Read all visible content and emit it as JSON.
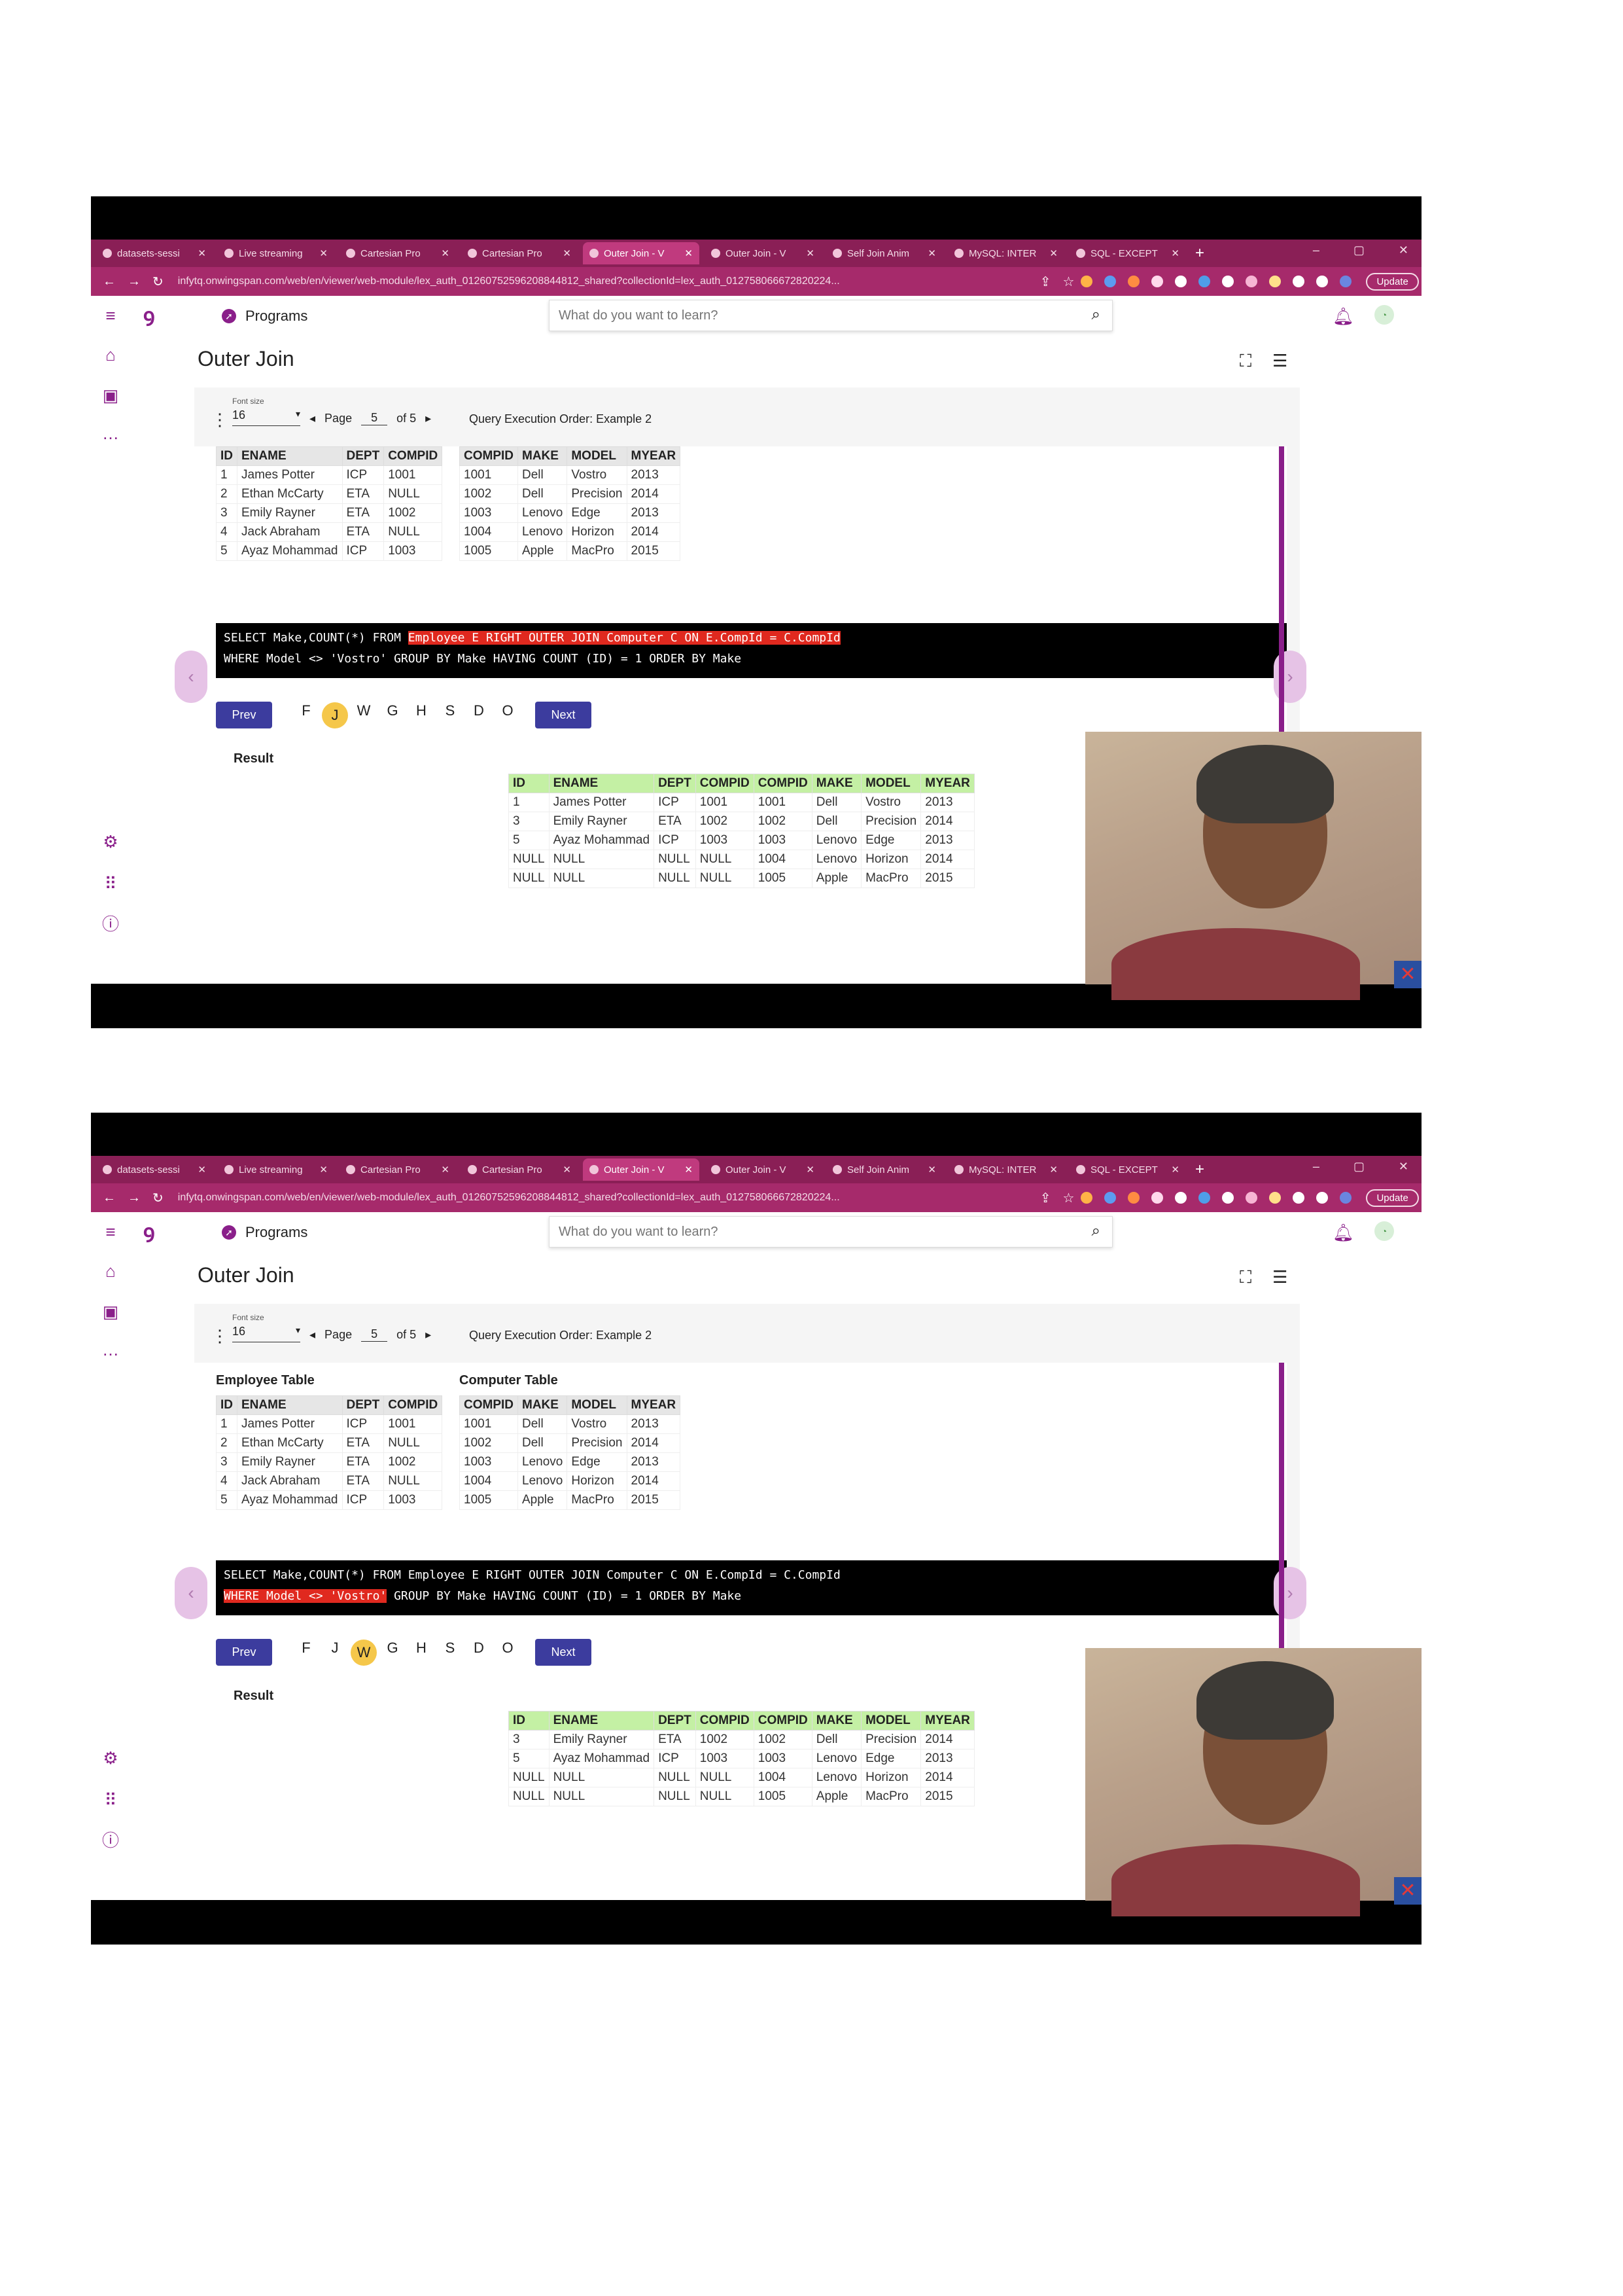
{
  "browser": {
    "tabs": [
      {
        "title": "datasets-sessi",
        "active": false
      },
      {
        "title": "Live streaming",
        "active": false
      },
      {
        "title": "Cartesian Pro",
        "active": false
      },
      {
        "title": "Cartesian Pro",
        "active": false
      },
      {
        "title": "Outer Join - V",
        "active": true
      },
      {
        "title": "Outer Join - V",
        "active": false
      },
      {
        "title": "Self Join Anim",
        "active": false
      },
      {
        "title": "MySQL: INTER",
        "active": false
      },
      {
        "title": "SQL - EXCEPT",
        "active": false
      }
    ],
    "url": "infytq.onwingspan.com/web/en/viewer/web-module/lex_auth_0126075259620884481​2_shared?collectionId=lex_auth_012758066672820224...",
    "update_label": "Update"
  },
  "app": {
    "programs_label": "Programs",
    "search_placeholder": "What do you want to learn?",
    "page_title": "Outer Join",
    "font_size_label": "Font size",
    "font_size_value": "16",
    "page_label": "Page",
    "page_value": "5",
    "page_of": "of 5",
    "query_title": "Query Execution Order: Example 2",
    "employee_table_title": "Employee Table",
    "computer_table_title": "Computer Table",
    "result_label": "Result",
    "prev_label": "Prev",
    "next_label": "Next"
  },
  "employee_table": {
    "headers": [
      "ID",
      "ENAME",
      "DEPT",
      "COMPID"
    ],
    "rows": [
      [
        "1",
        "James Potter",
        "ICP",
        "1001"
      ],
      [
        "2",
        "Ethan McCarty",
        "ETA",
        "NULL"
      ],
      [
        "3",
        "Emily Rayner",
        "ETA",
        "1002"
      ],
      [
        "4",
        "Jack Abraham",
        "ETA",
        "NULL"
      ],
      [
        "5",
        "Ayaz Mohammad",
        "ICP",
        "1003"
      ]
    ]
  },
  "computer_table": {
    "headers": [
      "COMPID",
      "MAKE",
      "MODEL",
      "MYEAR"
    ],
    "rows": [
      [
        "1001",
        "Dell",
        "Vostro",
        "2013"
      ],
      [
        "1002",
        "Dell",
        "Precision",
        "2014"
      ],
      [
        "1003",
        "Lenovo",
        "Edge",
        "2013"
      ],
      [
        "1004",
        "Lenovo",
        "Horizon",
        "2014"
      ],
      [
        "1005",
        "Apple",
        "MacPro",
        "2015"
      ]
    ]
  },
  "result_headers": [
    "ID",
    "ENAME",
    "DEPT",
    "COMPID",
    "COMPID",
    "MAKE",
    "MODEL",
    "MYEAR"
  ],
  "frames": [
    {
      "sql_line1_pre": "SELECT Make,COUNT(*) FROM ",
      "sql_line1_hl": "Employee E RIGHT OUTER JOIN Computer C ON E.CompId = C.CompId",
      "sql_line1_post": "",
      "sql_line2_hl": "",
      "sql_line2_post": "WHERE Model <> 'Vostro' GROUP BY Make HAVING COUNT (ID) = 1 ORDER BY Make",
      "steps": [
        "F",
        "J",
        "W",
        "G",
        "H",
        "S",
        "D",
        "O"
      ],
      "current_step": "J",
      "result_rows": [
        [
          "1",
          "James Potter",
          "ICP",
          "1001",
          "1001",
          "Dell",
          "Vostro",
          "2013"
        ],
        [
          "3",
          "Emily Rayner",
          "ETA",
          "1002",
          "1002",
          "Dell",
          "Precision",
          "2014"
        ],
        [
          "5",
          "Ayaz Mohammad",
          "ICP",
          "1003",
          "1003",
          "Lenovo",
          "Edge",
          "2013"
        ],
        [
          "NULL",
          "NULL",
          "NULL",
          "NULL",
          "1004",
          "Lenovo",
          "Horizon",
          "2014"
        ],
        [
          "NULL",
          "NULL",
          "NULL",
          "NULL",
          "1005",
          "Apple",
          "MacPro",
          "2015"
        ]
      ]
    },
    {
      "sql_line1_pre": "SELECT Make,COUNT(*) FROM Employee E RIGHT OUTER JOIN Computer C ON E.CompId = C.CompId",
      "sql_line1_hl": "",
      "sql_line1_post": "",
      "sql_line2_hl": "WHERE Model <> 'Vostro'",
      "sql_line2_post": " GROUP BY Make HAVING COUNT (ID) = 1 ORDER BY Make",
      "steps": [
        "F",
        "J",
        "W",
        "G",
        "H",
        "S",
        "D",
        "O"
      ],
      "current_step": "W",
      "result_rows": [
        [
          "3",
          "Emily Rayner",
          "ETA",
          "1002",
          "1002",
          "Dell",
          "Precision",
          "2014"
        ],
        [
          "5",
          "Ayaz Mohammad",
          "ICP",
          "1003",
          "1003",
          "Lenovo",
          "Edge",
          "2013"
        ],
        [
          "NULL",
          "NULL",
          "NULL",
          "NULL",
          "1004",
          "Lenovo",
          "Horizon",
          "2014"
        ],
        [
          "NULL",
          "NULL",
          "NULL",
          "NULL",
          "1005",
          "Apple",
          "MacPro",
          "2015"
        ]
      ]
    }
  ],
  "colors": {
    "tab_strip": "#8a1f56",
    "brand_purple": "#8a1f8a",
    "sql_highlight": "#e0291f",
    "result_header": "#c4f0a4",
    "current_step": "#f5c74a",
    "button": "#3c3c9e"
  }
}
